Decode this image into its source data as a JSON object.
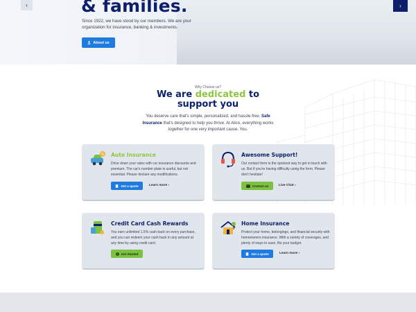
{
  "hero": {
    "title": "& families.",
    "text": "Since 1922, we have stood by our members. We are your organization for insurance, banking & investments.",
    "about_button": "About us",
    "prev_arrow": "‹",
    "next_arrow": "›"
  },
  "why": {
    "kicker": "Why Choose us?",
    "headline_part1": "We are ",
    "headline_accent": "dedicated",
    "headline_part2": " to",
    "headline_line2": "support you",
    "intro_before": "You deserve care that's simple, personalized, and hassle-free. ",
    "intro_bold": "Safe Insurance",
    "intro_after": " that's designed to help you thrive. At Alico, everything works together for one very important cause. You."
  },
  "cards": [
    {
      "title": "Auto Insurance",
      "title_color": "#8dc63f",
      "desc": "Drive down your rates with car insurance discounts and premium. The car's number plate is useful, but not essential. Please declare any modifications.",
      "button": "Get a quote",
      "link": "Learn more"
    },
    {
      "title": "Awesome Support!",
      "title_color": "#0b1f6b",
      "desc": "Our contact form is the quickest way to get in touch with us. But if you're having difficulty using the form. Please don't hesitate!",
      "button": "Contact us",
      "link": "Live Chat"
    },
    {
      "title": "Credit Card Cash Rewards",
      "title_color": "#0b1f6b",
      "desc": "You earn unlimited 1.5% cash back on every purchase, and you can redeem your cash back in any amount at any time by using credit card.",
      "button": "Get Started"
    },
    {
      "title": "Home Insurance",
      "title_color": "#0b1f6b",
      "desc": "Protect your home, belongings, and financial security with homeowners insurance. With a variety of coverages, and plenty of ways to save, fits your budget.",
      "button": "Get a quote",
      "link": "Learn more"
    }
  ],
  "colors": {
    "navy": "#0b1f6b",
    "accent_green": "#8dc63f",
    "button_blue": "#1f7be0",
    "button_green": "#7cc142"
  }
}
